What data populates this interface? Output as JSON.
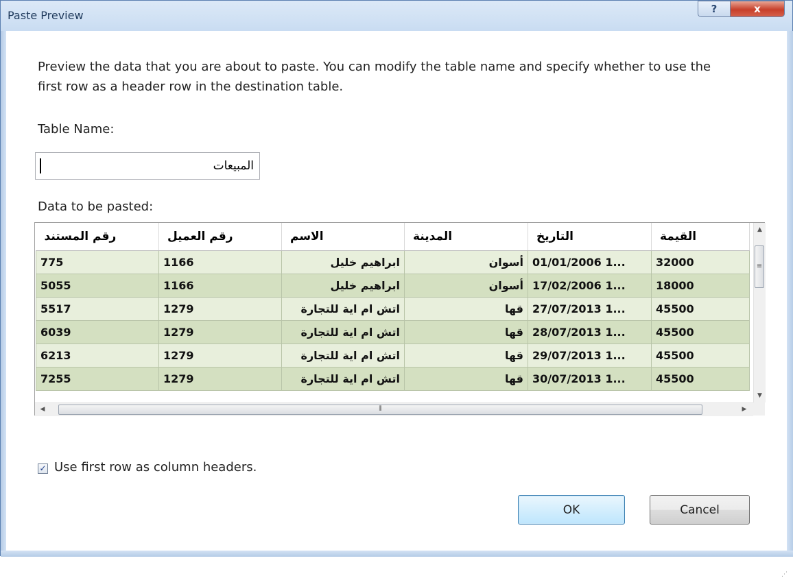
{
  "window": {
    "title": "Paste Preview"
  },
  "title_buttons": {
    "help": "?",
    "close": "x"
  },
  "description": "Preview the data that you are about to paste. You can modify the table name and specify whether to use the first row as a header row in the destination table.",
  "table_name": {
    "label": "Table Name:",
    "value": "المبيعات"
  },
  "data_label": "Data to be pasted:",
  "grid": {
    "columns": [
      "رقم المستند",
      "رقم العميل",
      "الاسم",
      "المدينة",
      "التاريخ",
      "القيمة"
    ],
    "rows": [
      [
        "775",
        "1166",
        "ابراهيم خليل",
        "أسوان",
        "01/01/2006 1...",
        "32000"
      ],
      [
        "5055",
        "1166",
        "ابراهيم خليل",
        "أسوان",
        "17/02/2006 1...",
        "18000"
      ],
      [
        "5517",
        "1279",
        "اتش ام اية للتجارة",
        "قها",
        "27/07/2013 1...",
        "45500"
      ],
      [
        "6039",
        "1279",
        "اتش ام اية للتجارة",
        "قها",
        "28/07/2013 1...",
        "45500"
      ],
      [
        "6213",
        "1279",
        "اتش ام اية للتجارة",
        "قها",
        "29/07/2013 1...",
        "45500"
      ],
      [
        "7255",
        "1279",
        "اتش ام اية للتجارة",
        "قها",
        "30/07/2013 1...",
        "45500"
      ]
    ]
  },
  "checkbox": {
    "label": "Use first row as column headers.",
    "checked": true
  },
  "buttons": {
    "ok": "OK",
    "cancel": "Cancel"
  }
}
